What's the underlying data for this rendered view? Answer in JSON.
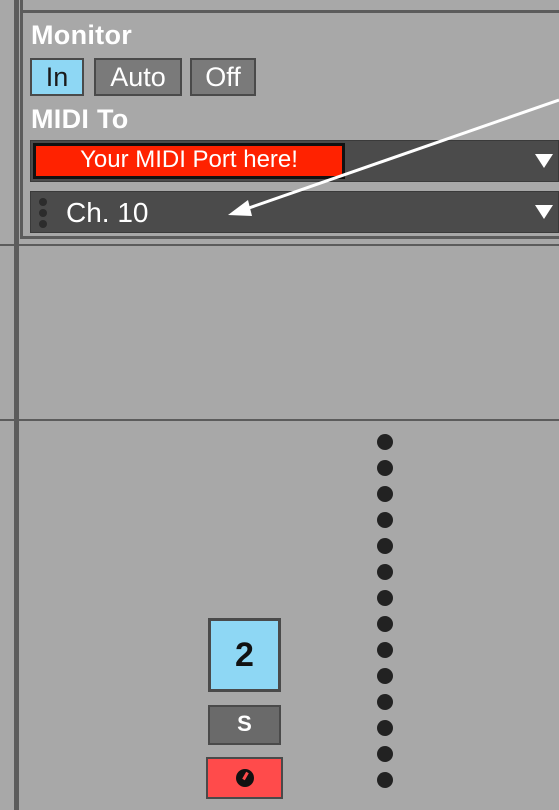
{
  "monitor": {
    "label": "Monitor",
    "options": [
      "In",
      "Auto",
      "Off"
    ],
    "selected": "In"
  },
  "midi_to": {
    "label": "MIDI To",
    "port_placeholder": "Your MIDI Port here!",
    "channel": "Ch. 10"
  },
  "track": {
    "number": "2",
    "solo_label": "S"
  },
  "colors": {
    "panel_bg": "#a8a8a8",
    "active_blue": "#8ed7f4",
    "port_red": "#ff2200",
    "arm_red": "#ff4b4b",
    "dropdown_bg": "#4b4b4b"
  }
}
